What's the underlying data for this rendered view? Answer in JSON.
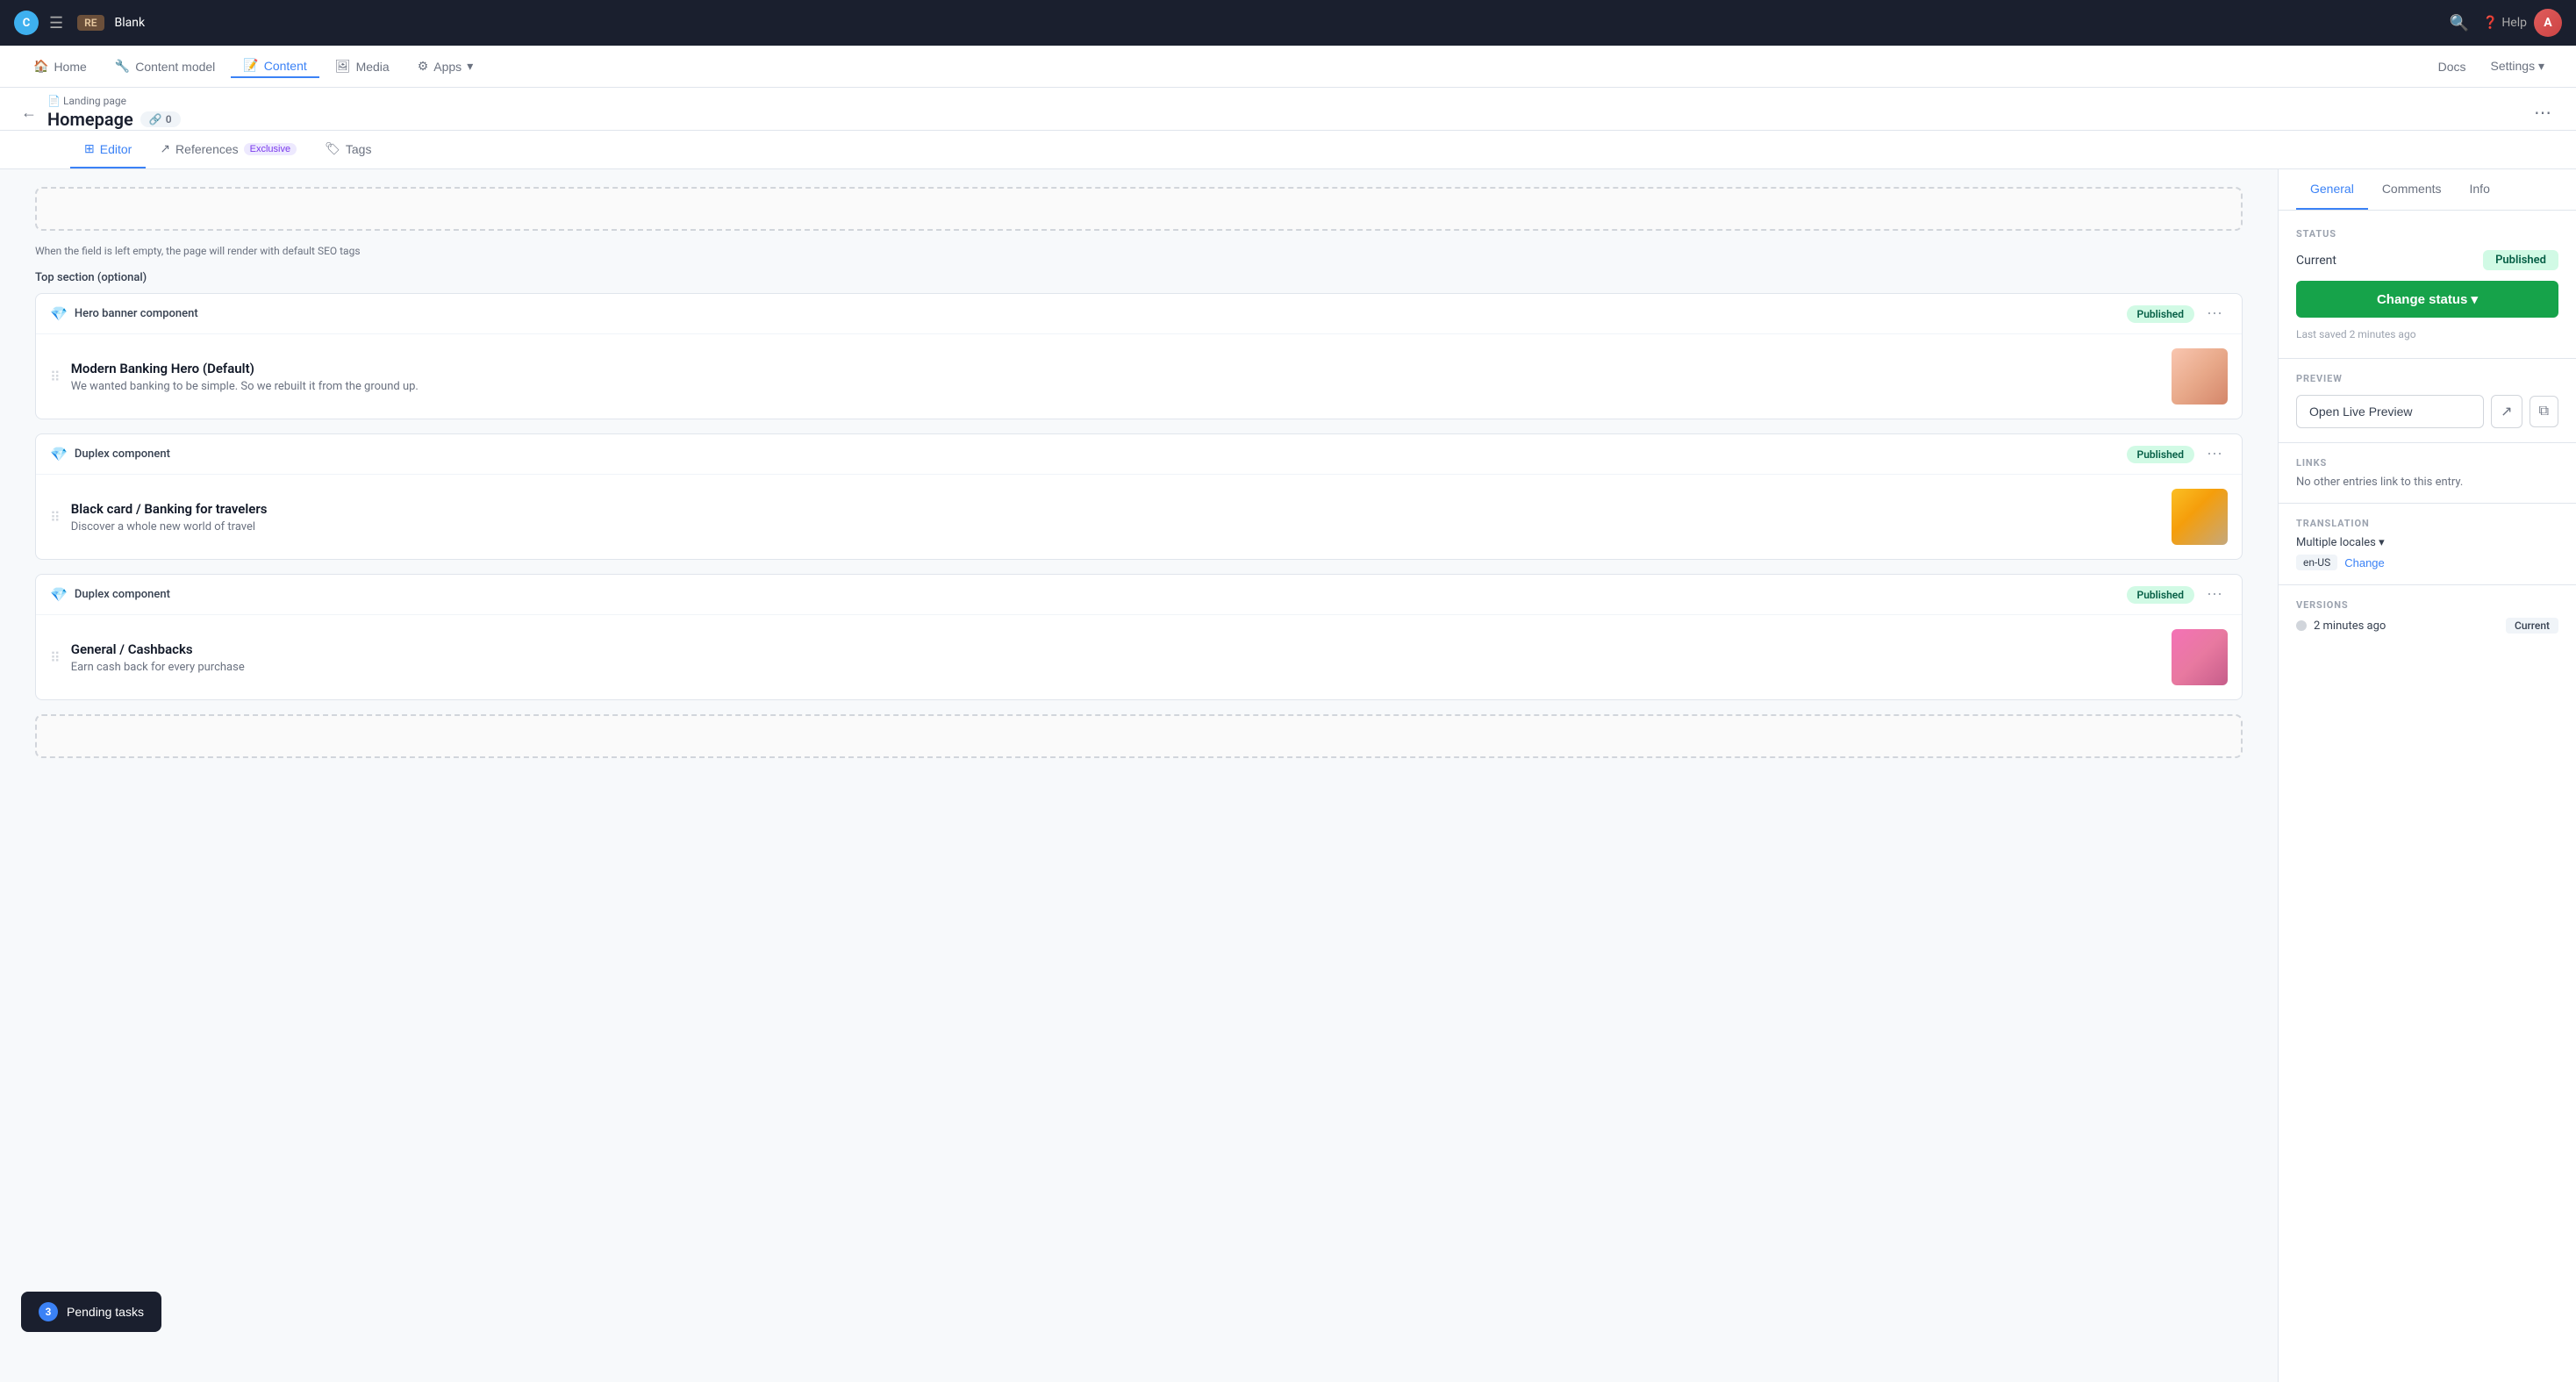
{
  "topNav": {
    "logo_letter": "C",
    "space_abbr": "RE",
    "space_name": "Blank",
    "help_label": "Help",
    "docs_label": "Docs",
    "settings_label": "Settings",
    "avatar_letter": "A"
  },
  "subNav": {
    "items": [
      {
        "id": "home",
        "label": "Home",
        "icon": "🏠"
      },
      {
        "id": "content-model",
        "label": "Content model",
        "icon": "🔧"
      },
      {
        "id": "content",
        "label": "Content",
        "icon": "📝",
        "active": true
      },
      {
        "id": "media",
        "label": "Media",
        "icon": "🖼"
      },
      {
        "id": "apps",
        "label": "Apps",
        "icon": "⚙",
        "has_dropdown": true
      }
    ],
    "docs_label": "Docs",
    "settings_label": "Settings ▾"
  },
  "breadcrumb": {
    "parent": "Landing page",
    "parent_icon": "📄",
    "title": "Homepage",
    "link_count": "0"
  },
  "tabs": [
    {
      "id": "editor",
      "label": "Editor",
      "icon": "⊞",
      "active": true
    },
    {
      "id": "references",
      "label": "References",
      "badge": "Exclusive"
    },
    {
      "id": "tags",
      "label": "Tags",
      "icon": "🏷"
    }
  ],
  "main": {
    "seo_hint": "When the field is left empty, the page will render with default SEO tags",
    "section_label": "Top section (optional)",
    "components": [
      {
        "id": "hero",
        "type": "Hero banner component",
        "status": "Published",
        "title": "Modern Banking Hero (Default)",
        "subtitle": "We wanted banking to be simple. So we rebuilt it from the ground up.",
        "thumb_class": "thumb-hero"
      },
      {
        "id": "duplex1",
        "type": "Duplex component",
        "status": "Published",
        "title": "Black card / Banking for travelers",
        "subtitle": "Discover a whole new world of travel",
        "thumb_class": "thumb-duplex1"
      },
      {
        "id": "duplex2",
        "type": "Duplex component",
        "status": "Published",
        "title": "General / Cashbacks",
        "subtitle": "Earn cash back for every purchase",
        "thumb_class": "thumb-duplex2"
      }
    ]
  },
  "sidebar": {
    "tabs": [
      {
        "id": "general",
        "label": "General",
        "active": true
      },
      {
        "id": "comments",
        "label": "Comments"
      },
      {
        "id": "info",
        "label": "Info"
      }
    ],
    "status": {
      "section_title": "STATUS",
      "current_label": "Current",
      "current_value": "Published",
      "change_status_label": "Change status ▾",
      "last_saved": "Last saved 2 minutes ago"
    },
    "preview": {
      "section_title": "PREVIEW",
      "button_label": "Open Live Preview"
    },
    "links": {
      "section_title": "LINKS",
      "text": "No other entries link to this entry."
    },
    "translation": {
      "section_title": "TRANSLATION",
      "locale": "en-US",
      "value": "Multiple locales ▾",
      "change_label": "Change"
    },
    "versions": {
      "section_title": "VERSIONS",
      "time": "2 minutes ago",
      "current_label": "Current"
    }
  },
  "pendingTasks": {
    "count": "3",
    "label": "Pending tasks"
  }
}
